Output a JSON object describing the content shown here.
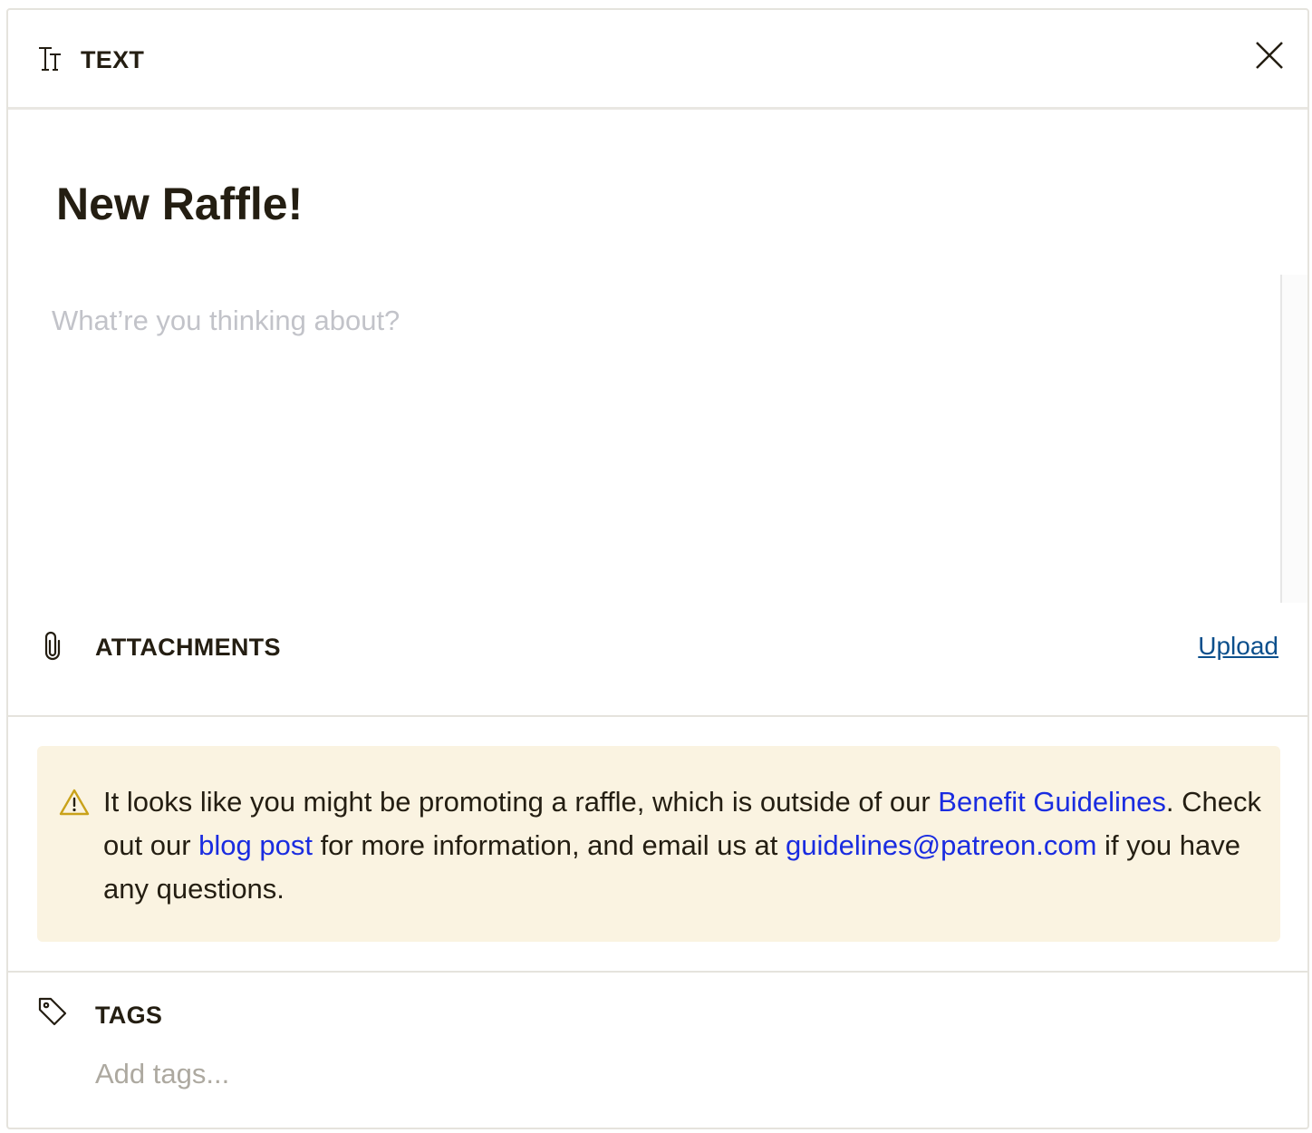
{
  "header": {
    "post_type_label": "TEXT",
    "type_icon": "text-size-icon",
    "close_icon": "close-icon"
  },
  "post": {
    "title": "New Raffle!",
    "body_placeholder": "What’re you thinking about?"
  },
  "attachments": {
    "label": "ATTACHMENTS",
    "icon": "paperclip-icon",
    "upload_label": "Upload"
  },
  "warning": {
    "icon": "warning-triangle-icon",
    "text_1": "It looks like you might be promoting a raffle, which is outside of our ",
    "link_guidelines": "Benefit Guidelines",
    "text_2": ". Check out our ",
    "link_blog": "blog post",
    "text_3": " for more information, and email us at ",
    "link_email": "guidelines@patreon.com",
    "text_4": " if you have any questions."
  },
  "tags": {
    "label": "TAGS",
    "icon": "tag-icon",
    "placeholder": "Add tags..."
  },
  "colors": {
    "text": "#241e12",
    "link": "#1a2ce0",
    "upload_link": "#0b4f8c",
    "warning_bg": "#faf3e1",
    "warning_icon": "#c9a21a",
    "placeholder": "#c2c3c9"
  }
}
